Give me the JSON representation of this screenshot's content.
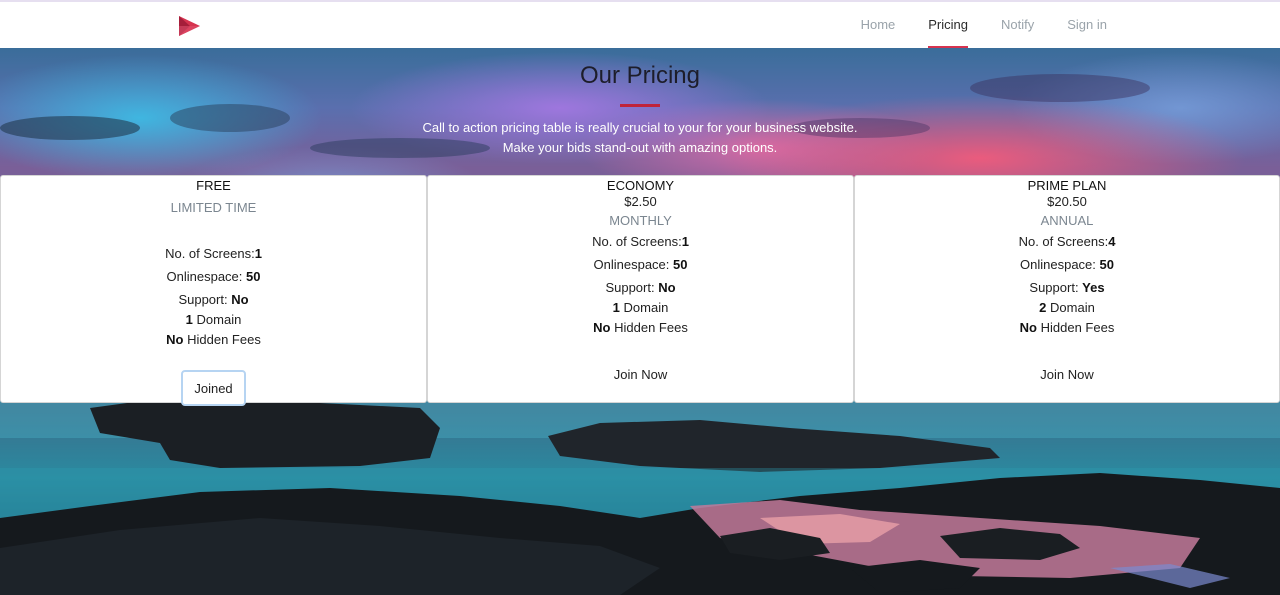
{
  "nav": {
    "logo_icon": "play-logo-icon",
    "brand_color": "#d6334f",
    "links": [
      {
        "label": "Home"
      },
      {
        "label": "Pricing",
        "active": true
      },
      {
        "label": "Notify"
      },
      {
        "label": "Sign in"
      }
    ]
  },
  "hero": {
    "title": "Our Pricing",
    "subtitle_line1": "Call to action pricing table is really crucial to your for your business website.",
    "subtitle_line2": "Make your bids stand-out with amazing options."
  },
  "plans": [
    {
      "name": "FREE",
      "price": "",
      "period": "LIMITED TIME",
      "screens_label": "No. of Screens:",
      "screens": "1",
      "space_label": "Onlinespace: ",
      "space": "50",
      "support_label": "Support: ",
      "support": "No",
      "domain_count": "1",
      "domain_label": " Domain",
      "fees_strong": "No",
      "fees_label": " Hidden Fees",
      "button": "Joined"
    },
    {
      "name": "ECONOMY",
      "price": "$2.50",
      "period": "MONTHLY",
      "screens_label": "No. of Screens:",
      "screens": "1",
      "space_label": "Onlinespace: ",
      "space": "50",
      "support_label": "Support: ",
      "support": "No",
      "domain_count": "1",
      "domain_label": " Domain",
      "fees_strong": "No",
      "fees_label": " Hidden Fees",
      "button": "Join Now"
    },
    {
      "name": "PRIME PLAN",
      "price": "$20.50",
      "period": "ANNUAL",
      "screens_label": "No. of Screens:",
      "screens": "4",
      "space_label": "Onlinespace: ",
      "space": "50",
      "support_label": "Support: ",
      "support": "Yes",
      "domain_count": "2",
      "domain_label": " Domain",
      "fees_strong": "No",
      "fees_label": " Hidden Fees",
      "button": "Join Now"
    }
  ]
}
